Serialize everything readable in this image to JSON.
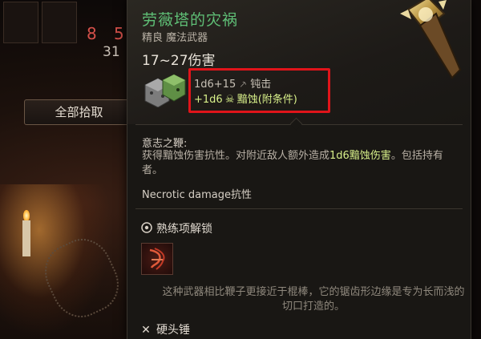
{
  "background": {
    "inventory_counts": {
      "red": "8",
      "red2": "5",
      "white": "31"
    },
    "loot_all_label": "全部拾取"
  },
  "tooltip": {
    "name": "劳薇塔的灾祸",
    "subtitle": "精良 魔法武器",
    "damage_range": "17~27伤害",
    "damage_lines": [
      {
        "dice": "1d6+15",
        "icon": "bludgeon-icon",
        "type": "钝击"
      },
      {
        "dice": "+1d6",
        "icon": "necrotic-icon",
        "type": "黯蚀(附条件)"
      }
    ],
    "ability": {
      "name": "意志之鞭:",
      "desc_part1": "获得黯蚀伤害抗性。对附近敌人额外造成",
      "desc_highlight": "1d6黯蚀伤害",
      "desc_part2": "。包括持有者。"
    },
    "resistance_line": "Necrotic damage抗性",
    "proficiency_label": "熟练项解锁",
    "flavor": "这种武器相比鞭子更接近于棍棒，它的锯齿形边缘是专为长而浅的切口打造的。",
    "weapon_type": "硬头锤"
  },
  "colors": {
    "name": "#5fbf76",
    "highlight": "#d8f08a",
    "callout_border": "#e0141a"
  }
}
